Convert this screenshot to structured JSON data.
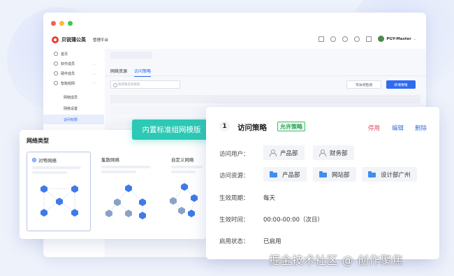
{
  "app": {
    "logo_text": "贝锐蒲公英",
    "logo_sub": "管理平台",
    "user_name": "PGY-Master"
  },
  "sidebar": {
    "items": [
      {
        "label": "首页"
      },
      {
        "label": "软件成员"
      },
      {
        "label": "硬件成员"
      },
      {
        "label": "智能组网"
      }
    ],
    "sub_items": [
      {
        "label": "网络成员"
      },
      {
        "label": "网络设置"
      },
      {
        "label": "访问权限"
      }
    ]
  },
  "content": {
    "tabs": [
      {
        "label": "网络资源"
      },
      {
        "label": "访问策略"
      }
    ],
    "search_placeholder": "按策略名称搜索",
    "check_button": "可访问检测",
    "add_button": "新增策略"
  },
  "network_types": {
    "title": "网络类型",
    "options": [
      {
        "label": "对等网络",
        "selected": true
      },
      {
        "label": "集散网络",
        "selected": false
      },
      {
        "label": "自定义网络",
        "selected": false
      }
    ]
  },
  "tag": {
    "label": "内置标准组网模版"
  },
  "policy": {
    "number": "1",
    "title": "访问策略",
    "badge": "允许策略",
    "actions": {
      "disable": "停用",
      "edit": "编辑",
      "delete": "删除"
    },
    "users_label": "访问用户：",
    "users": [
      "产品部",
      "财务部"
    ],
    "resources_label": "访问资源：",
    "resources": [
      "产品部",
      "网站部",
      "设计部广州"
    ],
    "period_label": "生效周期：",
    "period": "每天",
    "time_label": "生效时间：",
    "time": "00:00-00:00（次日）",
    "status_label": "启用状态：",
    "status": "已启用"
  },
  "colors": {
    "primary": "#2f6bf0",
    "teal": "#2cc9b4",
    "success": "#2f9f55",
    "danger": "#e0445a"
  },
  "watermark": "掘金技术社区 @ 创作聚焦"
}
